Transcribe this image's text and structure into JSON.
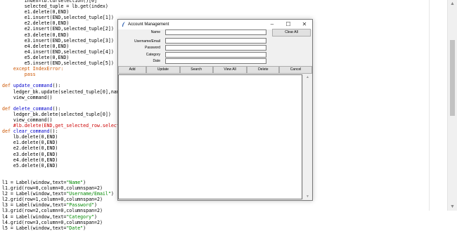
{
  "editor": {
    "lines": [
      [
        {
          "t": "        index=lb.curselection()[0]"
        }
      ],
      [
        {
          "t": "        selected_tuple = lb.get(index)"
        }
      ],
      [
        {
          "t": "        e1.delete(0,END)"
        }
      ],
      [
        {
          "t": "        e1.insert(END,selected_tuple[1])"
        }
      ],
      [
        {
          "t": "        e2.delete(0,END)"
        }
      ],
      [
        {
          "t": "        e2.insert(END,selected_tuple[2])"
        }
      ],
      [
        {
          "t": "        e3.delete(0,END)"
        }
      ],
      [
        {
          "t": "        e3.insert(END,selected_tuple[3])"
        }
      ],
      [
        {
          "t": "        e4.delete(0,END)"
        }
      ],
      [
        {
          "t": "        e4.insert(END,selected_tuple[4])"
        }
      ],
      [
        {
          "t": "        e5.delete(0,END)"
        }
      ],
      [
        {
          "t": "        e5.insert(END,selected_tuple[5])"
        }
      ],
      [
        {
          "t": "    except IndexError:",
          "c": "kw"
        }
      ],
      [
        {
          "t": "        pass",
          "c": "kw"
        }
      ],
      [
        {
          "t": ""
        }
      ],
      [
        {
          "t": "def ",
          "c": "kw"
        },
        {
          "t": "update_command",
          "c": "fn"
        },
        {
          "t": "():"
        }
      ],
      [
        {
          "t": "    ledger_bk.update(selected_tuple[0],name"
        }
      ],
      [
        {
          "t": "    view_command()"
        }
      ],
      [
        {
          "t": ""
        }
      ],
      [
        {
          "t": "def ",
          "c": "kw"
        },
        {
          "t": "delete_command",
          "c": "fn"
        },
        {
          "t": "():"
        }
      ],
      [
        {
          "t": "    ledger_bk.delete(selected_tuple[0])"
        }
      ],
      [
        {
          "t": "    view_command()"
        }
      ],
      [
        {
          "t": "    #lb.delete(END,get_selected_row.selecte",
          "c": "cm"
        }
      ],
      [
        {
          "t": "def ",
          "c": "kw"
        },
        {
          "t": "clear_command",
          "c": "fn"
        },
        {
          "t": "():"
        }
      ],
      [
        {
          "t": "    lb.delete(0,END)"
        }
      ],
      [
        {
          "t": "    e1.delete(0,END)"
        }
      ],
      [
        {
          "t": "    e2.delete(0,END)"
        }
      ],
      [
        {
          "t": "    e3.delete(0,END)"
        }
      ],
      [
        {
          "t": "    e4.delete(0,END)"
        }
      ],
      [
        {
          "t": "    e5.delete(0,END)"
        }
      ],
      [
        {
          "t": ""
        }
      ],
      [
        {
          "t": ""
        }
      ],
      [
        {
          "t": "l1 = Label(window,text="
        },
        {
          "t": "\"Name\"",
          "c": "str"
        },
        {
          "t": ")"
        }
      ],
      [
        {
          "t": "l1.grid(row=0,column=0,columnspan=2)"
        }
      ],
      [
        {
          "t": "l2 = Label(window,text="
        },
        {
          "t": "\"Username/Email\"",
          "c": "str"
        },
        {
          "t": ")"
        }
      ],
      [
        {
          "t": "l2.grid(row=1,column=0,columnspan=2)"
        }
      ],
      [
        {
          "t": "l3 = Label(window,text="
        },
        {
          "t": "\"Password\"",
          "c": "str"
        },
        {
          "t": ")"
        }
      ],
      [
        {
          "t": "l3.grid(row=2,column=0,columnspan=2)"
        }
      ],
      [
        {
          "t": "l4 = Label(window,text="
        },
        {
          "t": "\"Category\"",
          "c": "str"
        },
        {
          "t": ")"
        }
      ],
      [
        {
          "t": "l4.grid(row=3,column=0,columnspan=2)"
        }
      ],
      [
        {
          "t": "l5 = Label(window,text="
        },
        {
          "t": "\"Date\"",
          "c": "str"
        },
        {
          "t": ")"
        }
      ]
    ]
  },
  "window": {
    "title": "Account Management",
    "minimize_icon": "minimize-icon",
    "maximize_icon": "maximize-icon",
    "close_icon": "close-icon",
    "labels": [
      "Name",
      "Username/Email",
      "Password",
      "Category",
      "Date"
    ],
    "clear_button": "Clear All",
    "buttons": [
      "Add",
      "Update",
      "Search",
      "View All",
      "Delete",
      "Cancel"
    ]
  },
  "colors": {
    "keyword": "#cc5500",
    "function": "#0000cc",
    "string": "#008800",
    "comment": "#cc0000"
  }
}
